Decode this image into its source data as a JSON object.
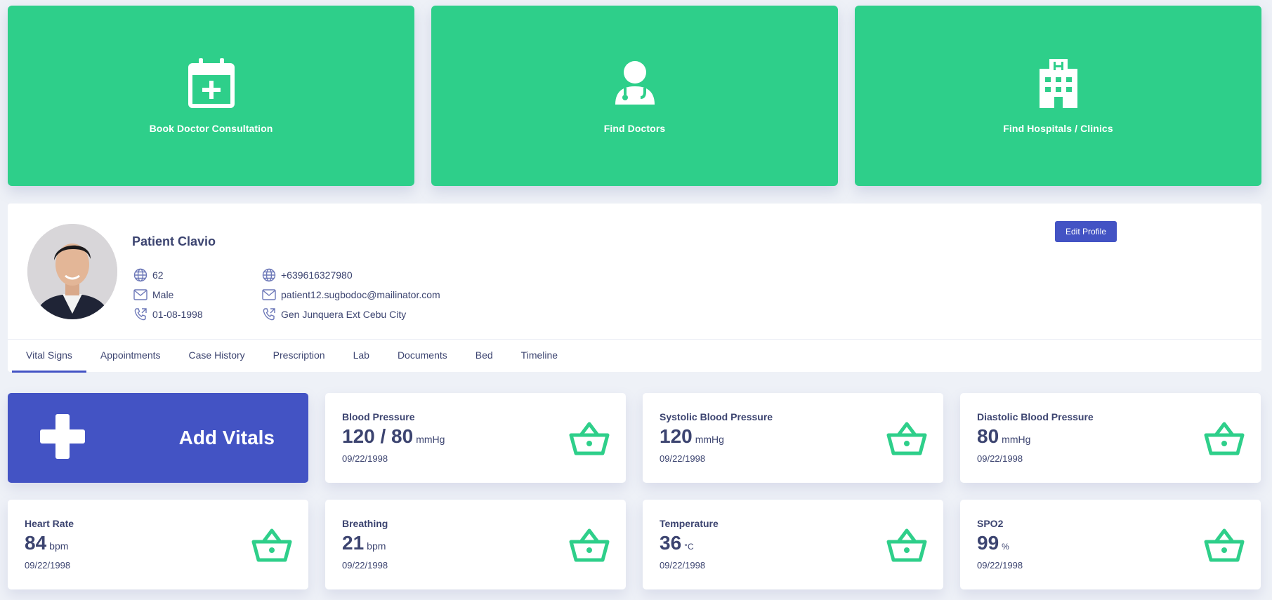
{
  "actions": [
    {
      "label": "Book Doctor Consultation",
      "icon": "calendar-plus-icon"
    },
    {
      "label": "Find Doctors",
      "icon": "doctor-icon"
    },
    {
      "label": "Find Hospitals / Clinics",
      "icon": "hospital-icon"
    }
  ],
  "profile": {
    "name": "Patient Clavio",
    "edit_label": "Edit Profile",
    "left_info": [
      {
        "icon": "globe-icon",
        "value": "62"
      },
      {
        "icon": "mail-icon",
        "value": "Male"
      },
      {
        "icon": "phone-icon",
        "value": "01-08-1998"
      }
    ],
    "right_info": [
      {
        "icon": "globe-icon",
        "value": "+639616327980"
      },
      {
        "icon": "mail-icon",
        "value": "patient12.sugbodoc@mailinator.com"
      },
      {
        "icon": "phone-icon",
        "value": "Gen Junquera Ext Cebu City"
      }
    ]
  },
  "tabs": [
    "Vital Signs",
    "Appointments",
    "Case History",
    "Prescription",
    "Lab",
    "Documents",
    "Bed",
    "Timeline"
  ],
  "active_tab": "Vital Signs",
  "add_vitals_label": "Add Vitals",
  "vitals": [
    {
      "title": "Blood Pressure",
      "value": "120 / 80",
      "unit": "mmHg",
      "date": "09/22/1998"
    },
    {
      "title": "Systolic Blood Pressure",
      "value": "120",
      "unit": "mmHg",
      "date": "09/22/1998"
    },
    {
      "title": "Diastolic Blood Pressure",
      "value": "80",
      "unit": "mmHg",
      "date": "09/22/1998"
    },
    {
      "title": "Heart Rate",
      "value": "84",
      "unit": "bpm",
      "date": "09/22/1998"
    },
    {
      "title": "Breathing",
      "value": "21",
      "unit": "bpm",
      "date": "09/22/1998"
    },
    {
      "title": "Temperature",
      "value": "36",
      "unit": "°C",
      "date": "09/22/1998"
    },
    {
      "title": "SPO2",
      "value": "99",
      "unit": "%",
      "date": "09/22/1998"
    }
  ],
  "colors": {
    "accent_green": "#2ecf8a",
    "primary_blue": "#4353c4",
    "text": "#3c4470",
    "background": "#eef1f7"
  }
}
